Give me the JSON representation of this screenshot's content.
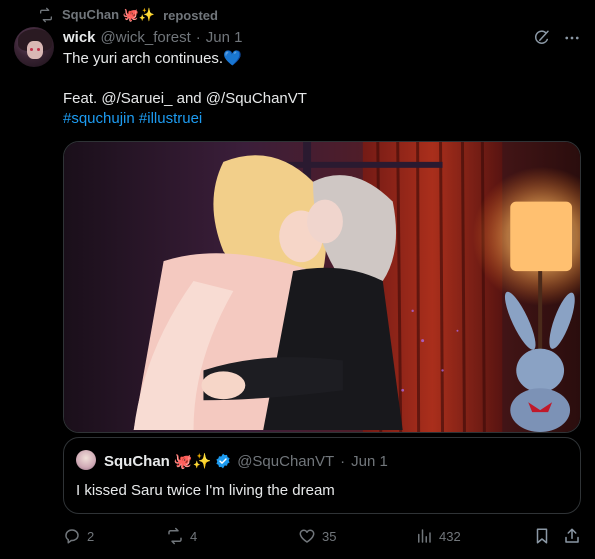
{
  "repost": {
    "icon": "repost-icon",
    "user": "SquChan",
    "emoji": "🐙✨",
    "label": "reposted"
  },
  "post": {
    "author_name": "wick",
    "handle": "@wick_forest",
    "separator": "·",
    "date": "Jun 1",
    "line1": "The yuri arch continues.",
    "line1_emoji": "💙",
    "line2": "Feat. @/Saruei_ and @/SquChanVT",
    "hashtag1": "#squchujin",
    "hashtag2": "#illustruei",
    "icons": {
      "grok": "grok-icon",
      "more": "more-icon"
    }
  },
  "quote": {
    "name": "SquChan",
    "emoji": "🐙✨",
    "verified_icon": "verified-badge-icon",
    "handle": "@SquChanVT",
    "separator": "·",
    "date": "Jun 1",
    "text": "I kissed Saru twice I'm living the dream"
  },
  "actions": {
    "replies": "2",
    "reposts": "4",
    "likes": "35",
    "views": "432"
  },
  "colors": {
    "background": "#000000",
    "text": "#e7e9ea",
    "muted": "#71767b",
    "link": "#1d9bf0",
    "border": "#2f3336",
    "verified": "#1d9bf0"
  }
}
